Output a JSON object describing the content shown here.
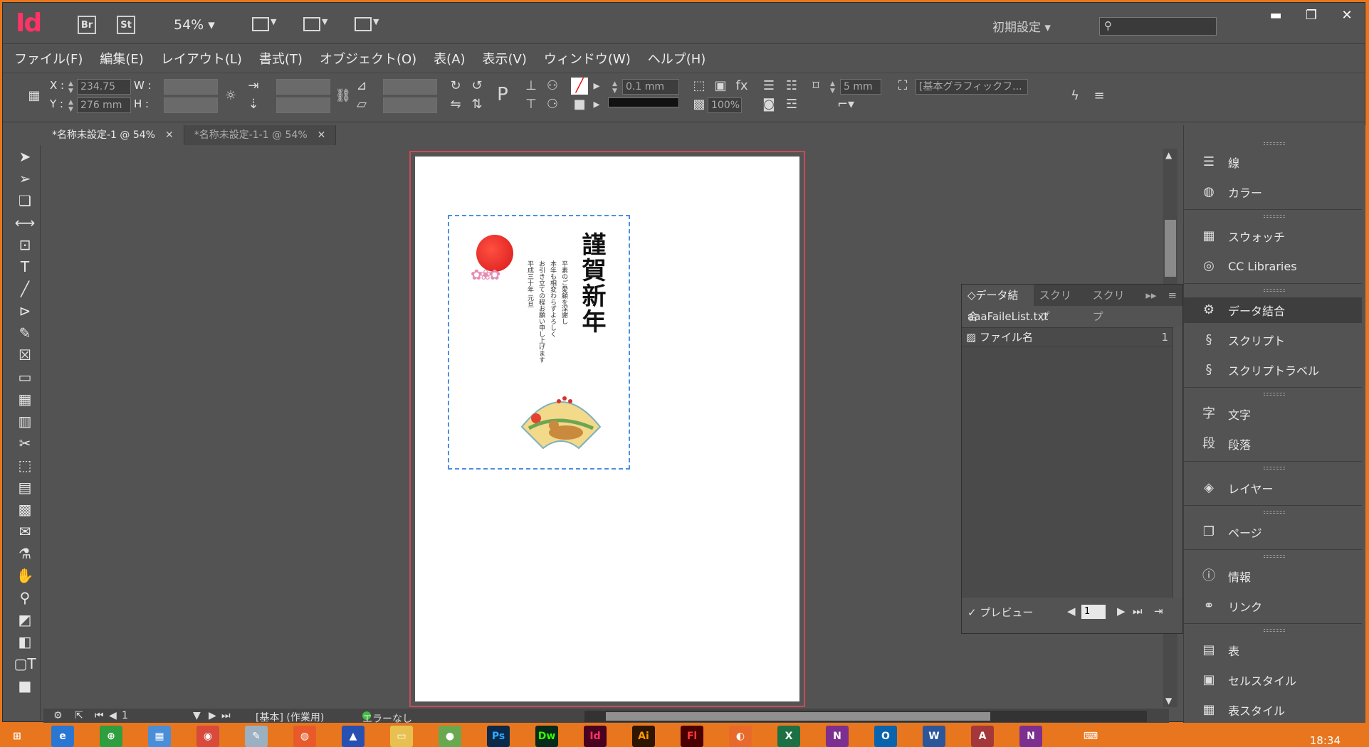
{
  "app": {
    "logo": "Id",
    "bridge": "Br",
    "stock": "St",
    "zoom": "54% ▾",
    "workspace": "初期設定 ▾",
    "window_buttons": [
      "▬",
      "❐",
      "✕"
    ]
  },
  "menu": [
    "ファイル(F)",
    "編集(E)",
    "レイアウト(L)",
    "書式(T)",
    "オブジェクト(O)",
    "表(A)",
    "表示(V)",
    "ウィンドウ(W)",
    "ヘルプ(H)"
  ],
  "control": {
    "x_label": "X :",
    "x_value": "234.75 mm",
    "y_label": "Y :",
    "y_value": "276 mm",
    "w_label": "W :",
    "h_label": "H :",
    "stroke_weight": "0.1 mm",
    "opacity": "100%",
    "offset": "5 mm",
    "object_style": "[基本グラフィックフ..."
  },
  "doc_tabs": [
    {
      "label": "*名称未設定-1 @ 54%",
      "close": "✕"
    },
    {
      "label": "*名称未設定-1-1 @ 54%",
      "close": "✕"
    }
  ],
  "card": {
    "greeting": "謹賀新年",
    "letter_lines": [
      "平素のご愛顧を深謝し",
      "本年も相変わらずよろしく",
      "お引き立ての程お願い申し上げます",
      "平成三十年 元旦"
    ]
  },
  "status": {
    "page": "1",
    "master": "[基本] (作業用)",
    "errors": "エラーなし"
  },
  "dock": [
    {
      "label": "線",
      "icon": "stroke-icon"
    },
    {
      "label": "カラー",
      "icon": "color-icon"
    },
    {
      "label": "スウォッチ",
      "icon": "swatches-icon"
    },
    {
      "label": "CC Libraries",
      "icon": "cc-libraries-icon"
    },
    {
      "label": "データ結合",
      "icon": "data-merge-icon"
    },
    {
      "label": "スクリプト",
      "icon": "script-icon"
    },
    {
      "label": "スクリプトラベル",
      "icon": "script-label-icon"
    },
    {
      "label": "文字",
      "icon": "character-icon"
    },
    {
      "label": "段落",
      "icon": "paragraph-icon"
    },
    {
      "label": "レイヤー",
      "icon": "layers-icon"
    },
    {
      "label": "ページ",
      "icon": "pages-icon"
    },
    {
      "label": "情報",
      "icon": "info-icon"
    },
    {
      "label": "リンク",
      "icon": "links-icon"
    },
    {
      "label": "表",
      "icon": "table-icon"
    },
    {
      "label": "セルスタイル",
      "icon": "cell-style-icon"
    },
    {
      "label": "表スタイル",
      "icon": "table-style-icon"
    }
  ],
  "data_merge": {
    "tabs": [
      "◇データ結合",
      "スクリプ",
      "スクリプ"
    ],
    "source_file": "aaaFaileList.txt",
    "field_name": "ファイル名",
    "field_count": "1",
    "preview_label": "✓ プレビュー",
    "record": "1"
  },
  "taskbar": {
    "time": "18:34"
  }
}
